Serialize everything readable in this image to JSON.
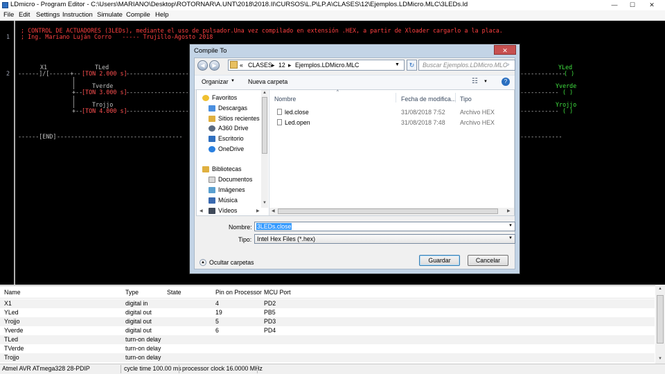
{
  "window": {
    "title": "LDmicro - Program Editor - C:\\Users\\MARIANO\\Desktop\\ROTORNAR\\A.UNT\\2018\\2018.II\\CURSOS\\L.P\\LP.A\\CLASES\\12\\Ejemplos.LDMicro.MLC\\3LEDs.ld",
    "minimize_glyph": "—",
    "maximize_glyph": "☐",
    "close_glyph": "✕"
  },
  "menu": [
    "File",
    "Edit",
    "Settings",
    "Instruction",
    "Simulate",
    "Compile",
    "Help"
  ],
  "editor": {
    "rung_numbers": [
      "1",
      "2"
    ],
    "comment_lines": [
      "; CONTROL DE ACTUADORES (3LEDs), mediante el uso de pulsador.Una vez compilado en extensión .HEX, a partir de Xloader cargarlo a la placa.",
      "; Ing. Mariano Luján Corro   ----- Trujillo-Agosto 2018"
    ],
    "contact_name": "X1",
    "contact_symbol": "------]/[",
    "branch_wire": "------+--",
    "timers": [
      {
        "name": "TLed",
        "text": "[TON 2.000 s]"
      },
      {
        "name": "Tverde",
        "text": "[TON 3.000 s]"
      },
      {
        "name": "Trojjo",
        "text": "[TON 4.000 s]"
      }
    ],
    "coils": [
      {
        "name": "YLed",
        "symbol": "( )"
      },
      {
        "name": "Yverde",
        "symbol": "( )"
      },
      {
        "name": "Yrojjo",
        "symbol": "( )"
      }
    ],
    "end_rung": "------[END]"
  },
  "variables": {
    "headers": [
      "Name",
      "Type",
      "State",
      "Pin on Processor",
      "MCU Port"
    ],
    "rows": [
      [
        "X1",
        "digital in",
        "",
        "4",
        "PD2"
      ],
      [
        "YLed",
        "digital out",
        "",
        "19",
        "PB5"
      ],
      [
        "Yrojjo",
        "digital out",
        "",
        "5",
        "PD3"
      ],
      [
        "Yverde",
        "digital out",
        "",
        "6",
        "PD4"
      ],
      [
        "TLed",
        "turn-on delay",
        "",
        "",
        ""
      ],
      [
        "TVerde",
        "turn-on delay",
        "",
        "",
        ""
      ],
      [
        "Trojjo",
        "turn-on delay",
        "",
        "",
        ""
      ]
    ]
  },
  "statusbar": {
    "processor": "Atmel AVR ATmega328 28-PDIP",
    "cycle": "cycle time 100.00 ms",
    "clock": "processor clock 16.0000 MHz"
  },
  "dialog": {
    "title": "Compile To",
    "close_glyph": "✕",
    "back_glyph": "◀",
    "forward_glyph": "▶",
    "address": {
      "prefix": "«",
      "parts": [
        "CLASES",
        "12",
        "Ejemplos.LDMicro.MLC"
      ],
      "sep": "▸"
    },
    "search_placeholder": "Buscar Ejemplos.LDMicro.MLC",
    "organize_label": "Organizar",
    "new_folder_label": "Nueva carpeta",
    "help_glyph": "?",
    "nav": {
      "favorites_label": "Favoritos",
      "favorites": [
        "Descargas",
        "Sitios recientes",
        "A360 Drive",
        "Escritorio",
        "OneDrive"
      ],
      "libraries_label": "Bibliotecas",
      "libraries": [
        "Documentos",
        "Imágenes",
        "Música",
        "Vídeos"
      ]
    },
    "columns": [
      "Nombre",
      "Fecha de modifica...",
      "Tipo"
    ],
    "files": [
      {
        "name": "led.close",
        "date": "31/08/2018 7:52",
        "type": "Archivo HEX"
      },
      {
        "name": "Led.open",
        "date": "31/08/2018 7:48",
        "type": "Archivo HEX"
      }
    ],
    "filename_label": "Nombre:",
    "filename_value": "3LEDs.close",
    "filetype_label": "Tipo:",
    "filetype_value": "Intel Hex Files (*.hex)",
    "hide_folders_label": "Ocultar carpetas",
    "save_label": "Guardar",
    "cancel_label": "Cancelar"
  },
  "colors": {
    "editor_bg": "#000000",
    "comment": "#ff4040",
    "ladder": "#c0c0c0",
    "coil": "#40e040",
    "dialog_frame": "#c3d4e6"
  }
}
